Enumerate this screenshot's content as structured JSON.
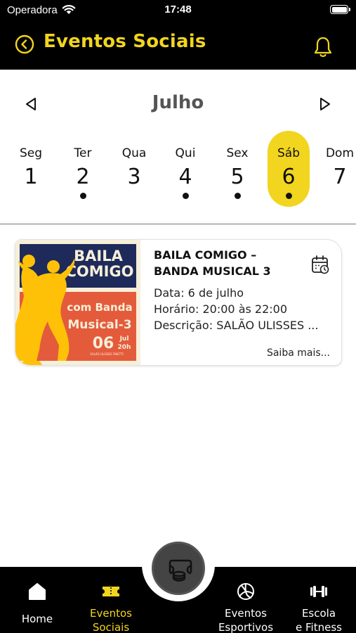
{
  "status": {
    "carrier": "Operadora",
    "time": "17:48"
  },
  "header": {
    "title": "Eventos Sociais"
  },
  "calendar": {
    "month": "Julho",
    "days": [
      {
        "name": "Seg",
        "num": "1"
      },
      {
        "name": "Ter",
        "num": "2"
      },
      {
        "name": "Qua",
        "num": "3"
      },
      {
        "name": "Qui",
        "num": "4"
      },
      {
        "name": "Sex",
        "num": "5"
      },
      {
        "name": "Sáb",
        "num": "6"
      },
      {
        "name": "Dom",
        "num": "7"
      }
    ]
  },
  "event": {
    "title": "BAILA COMIGO – BANDA MUSICAL 3",
    "date": "Data: 6 de julho",
    "time": "Horário: 20:00 às 22:00",
    "description": "Descrição: SALÃO ULISSES ...",
    "more": "Saiba mais...",
    "poster": {
      "line1": "BAILA",
      "line2": "COMIGO",
      "line3": "com Banda",
      "line4": "Musical-3",
      "day": "06",
      "month": "Jul",
      "hour": "20h",
      "venue": "SALÃO ULISSES FINETTI"
    }
  },
  "nav": {
    "home": "Home",
    "social_1": "Eventos",
    "social_2": "Sociais",
    "sports_1": "Eventos",
    "sports_2": "Esportivos",
    "school_1": "Escola",
    "school_2": "e Fitness"
  },
  "colors": {
    "accent": "#f2d51e",
    "header_bg": "#000000",
    "poster_navy": "#1e2a5a",
    "poster_red": "#e45b3c",
    "poster_yellow": "#ffc107"
  }
}
